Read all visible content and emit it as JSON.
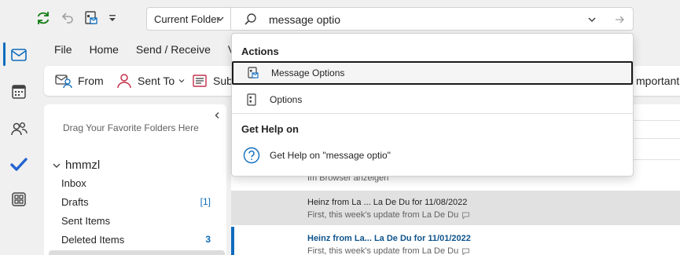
{
  "search": {
    "scope": "Current Folder",
    "query": "message optio"
  },
  "menu": [
    "File",
    "Home",
    "Send / Receive",
    "Vie"
  ],
  "ribbon": {
    "from_label": "From",
    "sent_to_label": "Sent To",
    "subject_label": "Sub",
    "important_label": "mportant"
  },
  "folder_pane": {
    "favorites_hint": "Drag Your Favorite Folders Here",
    "account": "hmmzl",
    "folders": [
      {
        "name": "Inbox",
        "count": ""
      },
      {
        "name": "Drafts",
        "count": "[1]"
      },
      {
        "name": "Sent Items",
        "count": ""
      },
      {
        "name": "Deleted Items",
        "count": "3"
      }
    ]
  },
  "message_list": {
    "browser_link": "Im Browser anzeigen",
    "messages": [
      {
        "from": "Heinz from La ...  La De Du for 11/08/2022",
        "preview": "First, this week's update from La De Du"
      },
      {
        "from": "Heinz from La...  La De Du for 11/01/2022",
        "preview": "First, this week's update from La De Du"
      }
    ]
  },
  "suggestions": {
    "actions_header": "Actions",
    "actions": [
      "Message Options",
      "Options"
    ],
    "help_header": "Get Help on",
    "help_item": "Get Help on \"message optio\""
  },
  "colors": {
    "accent": "#0f6cbd",
    "sync_green": "#0f7b0f",
    "people_red": "#c4314b"
  }
}
